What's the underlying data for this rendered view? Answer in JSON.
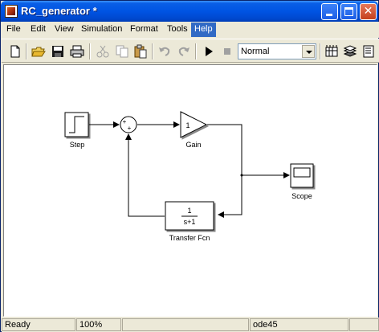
{
  "window": {
    "title": "RC_generator *"
  },
  "menubar": {
    "items": [
      "File",
      "Edit",
      "View",
      "Simulation",
      "Format",
      "Tools",
      "Help"
    ],
    "active": "Help"
  },
  "toolbar": {
    "icons": [
      "new-icon",
      "open-icon",
      "save-icon",
      "print-icon",
      "cut-icon",
      "copy-icon",
      "paste-icon",
      "undo-icon",
      "redo-icon",
      "start-simulation-icon",
      "stop-simulation-icon",
      "library-browser-icon",
      "model-explorer-icon",
      "debug-icon"
    ],
    "sim_mode": "Normal"
  },
  "diagram": {
    "blocks": {
      "step": {
        "label": "Step"
      },
      "sum": {
        "signs": [
          "+",
          "+"
        ]
      },
      "gain": {
        "label": "Gain",
        "value": "1"
      },
      "scope": {
        "label": "Scope"
      },
      "transfer_fcn": {
        "label": "Transfer Fcn",
        "numerator": "1",
        "denominator": "s+1"
      }
    }
  },
  "statusbar": {
    "status": "Ready",
    "zoom": "100%",
    "cell3": "",
    "solver": "ode45",
    "cell5": ""
  },
  "colors": {
    "titlebar": "#0054E3",
    "menu_highlight": "#316AC5",
    "chrome": "#ECE9D8"
  }
}
